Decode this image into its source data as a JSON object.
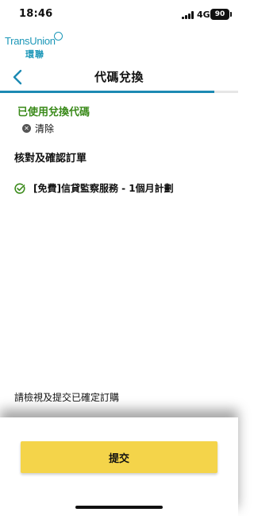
{
  "status_bar": {
    "time": "18:46",
    "network": "4G",
    "battery": "90"
  },
  "brand": {
    "name": "TransUnion",
    "name_cn": "環聯",
    "icon": "transunion-logo"
  },
  "header": {
    "title": "代碼兌換",
    "back_icon": "chevron-left-icon",
    "progress": 0.9
  },
  "promo": {
    "status_label": "已使用兌換代碼",
    "clear_label": "清除",
    "clear_icon": "close-circle-icon"
  },
  "order": {
    "section_title": "核對及確認訂單",
    "items": [
      {
        "label": "[免費]信貸監察服務 - 1個月計劃",
        "icon": "check-circle-icon"
      }
    ]
  },
  "footer": {
    "review_text": "請檢視及提交已確定訂購",
    "submit_label": "提交"
  },
  "colors": {
    "brand": "#1c97b8",
    "accent_green": "#3a8a1a",
    "button_yellow": "#f4d44a",
    "progress_blue": "#1c8ab3"
  }
}
